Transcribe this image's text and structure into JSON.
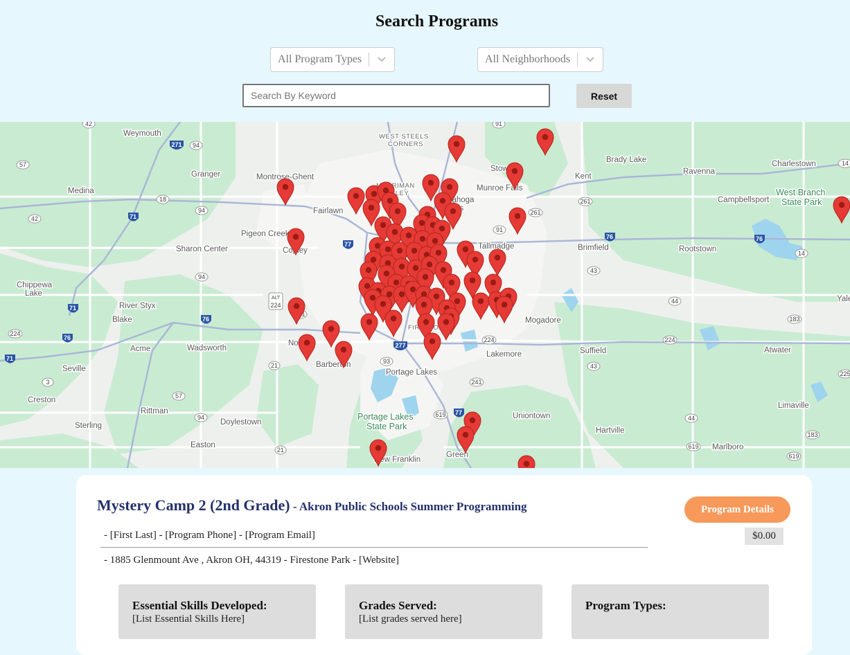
{
  "header": {
    "title": "Search Programs"
  },
  "filters": {
    "program_types": {
      "selected": "All Program Types"
    },
    "neighborhoods": {
      "selected": "All Neighborhoods"
    },
    "keyword": {
      "placeholder": "Search By Keyword",
      "value": ""
    },
    "reset_label": "Reset"
  },
  "map": {
    "places": [
      "Weymouth",
      "Granger",
      "Medina",
      "Montrose-Ghent",
      "Fairlawn",
      "Pigeon Creek",
      "Copley",
      "Sharon Center",
      "Chippewa Lake",
      "River Styx",
      "Blake",
      "Wadsworth",
      "Acme",
      "Norton",
      "Barberton",
      "Seville",
      "Creston",
      "Rittman",
      "Sterling",
      "Doylestown",
      "Easton",
      "Portage Lakes",
      "New Franklin",
      "Green",
      "Uniontown",
      "Hartville",
      "Lakemore",
      "Mogadore",
      "Suffield",
      "Tallmadge",
      "Stow",
      "Munroe Falls",
      "Cuyahoga Falls",
      "Kent",
      "Brady Lake",
      "Ravenna",
      "Charlestown",
      "Campbellsport",
      "Rootstown",
      "Brimfield",
      "Atwater",
      "Limaville",
      "Marlboro",
      "West Branch State Park",
      "Portage Lakes State Park",
      "Merriman Valley",
      "West Steels Corners",
      "Firestone Park",
      "Yale"
    ],
    "marker_color": "#e53a35"
  },
  "program": {
    "name": "Mystery Camp 2 (2nd Grade)",
    "separator": " - ",
    "organization": "Akron Public Schools Summer Programming",
    "details_label": "Program Details",
    "contact": "- [First Last] - [Program Phone] - [Program Email]",
    "price": "$0.00",
    "address": "- 1885 Glenmount Ave , Akron OH, 44319 - Firestone Park - [Website]",
    "boxes": [
      {
        "title": "Essential Skills Developed:",
        "text": "[List Essential Skills Here]"
      },
      {
        "title": "Grades Served:",
        "text": "[List grades served here]"
      },
      {
        "title": "Program Types:",
        "text": ""
      }
    ]
  }
}
